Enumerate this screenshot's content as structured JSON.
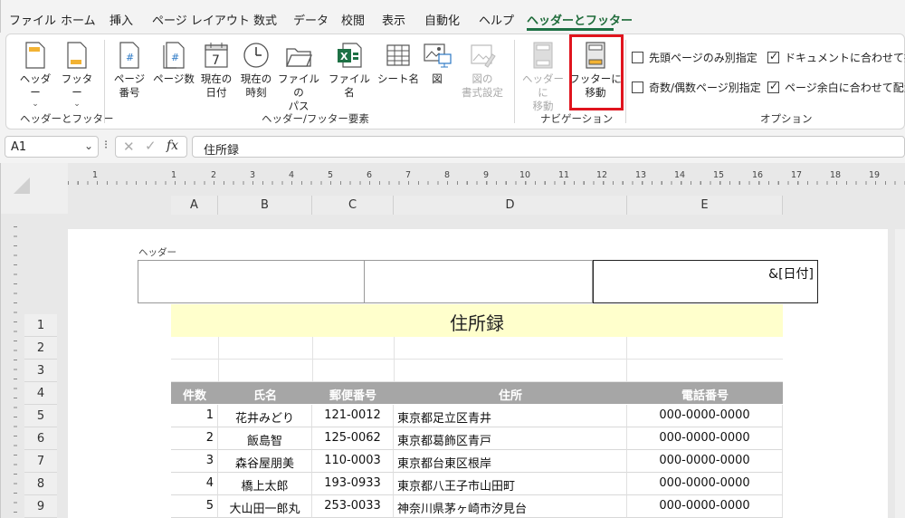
{
  "menu": {
    "items": [
      "ファイル",
      "ホーム",
      "挿入",
      "ページ レイアウト",
      "数式",
      "データ",
      "校閲",
      "表示",
      "自動化",
      "ヘルプ",
      "ヘッダーとフッター"
    ],
    "active": "ヘッダーとフッター"
  },
  "ribbon": {
    "header_btn": {
      "label": "ヘッダー"
    },
    "footer_btn": {
      "label": "フッター"
    },
    "group1_label": "ヘッダーとフッター",
    "page_number": {
      "line1": "ページ",
      "line2": "番号"
    },
    "page_count": {
      "label": "ページ数"
    },
    "current_date": {
      "line1": "現在の",
      "line2": "日付",
      "icon_text": "7"
    },
    "current_time": {
      "line1": "現在の",
      "line2": "時刻"
    },
    "file_path": {
      "line1": "ファイルの",
      "line2": "パス"
    },
    "file_name": {
      "label": "ファイル名"
    },
    "sheet_name": {
      "label": "シート名"
    },
    "picture": {
      "label": "図"
    },
    "format_picture": {
      "line1": "図の",
      "line2": "書式設定"
    },
    "group2_label": "ヘッダー/フッター要素",
    "goto_header": {
      "line1": "ヘッダーに",
      "line2": "移動"
    },
    "goto_footer": {
      "line1": "フッターに",
      "line2": "移動"
    },
    "group3_label": "ナビゲーション",
    "options": {
      "different_first": "先頭ページのみ別指定",
      "different_odd_even": "奇数/偶数ページ別指定",
      "scale_with_doc": "ドキュメントに合わせて拡大/",
      "align_margins": "ページ余白に合わせて配置"
    },
    "group4_label": "オプション"
  },
  "formula_bar": {
    "name_box": "A1",
    "formula": "住所録",
    "fx": "fx"
  },
  "sheet": {
    "ruler_numbers": [
      "1",
      "1",
      "2",
      "3",
      "4",
      "5",
      "6",
      "7",
      "8",
      "9",
      "10",
      "11",
      "12",
      "13",
      "14",
      "15",
      "16",
      "17",
      "18",
      "19"
    ],
    "columns": [
      "A",
      "B",
      "C",
      "D",
      "E"
    ],
    "rows": [
      "1",
      "2",
      "3",
      "4",
      "5",
      "6",
      "7",
      "8",
      "9"
    ],
    "header_label": "ヘッダー",
    "header_right_text": "&[日付]",
    "title": "住所録",
    "table": {
      "headers": [
        "件数",
        "氏名",
        "郵便番号",
        "住所",
        "電話番号"
      ],
      "rows": [
        [
          "1",
          "花井みどり",
          "121-0012",
          "東京都足立区青井",
          "000-0000-0000"
        ],
        [
          "2",
          "飯島智",
          "125-0062",
          "東京都葛飾区青戸",
          "000-0000-0000"
        ],
        [
          "3",
          "森谷屋朋美",
          "110-0003",
          "東京都台東区根岸",
          "000-0000-0000"
        ],
        [
          "4",
          "橋上太郎",
          "193-0933",
          "東京都八王子市山田町",
          "000-0000-0000"
        ],
        [
          "5",
          "大山田一郎丸",
          "253-0033",
          "神奈川県茅ヶ崎市汐見台",
          "000-0000-0000"
        ]
      ]
    }
  },
  "colors": {
    "accent": "#1e7145",
    "highlight": "#e0141e",
    "title_fill": "#ffffcc",
    "table_header_fill": "#a6a6a6"
  }
}
